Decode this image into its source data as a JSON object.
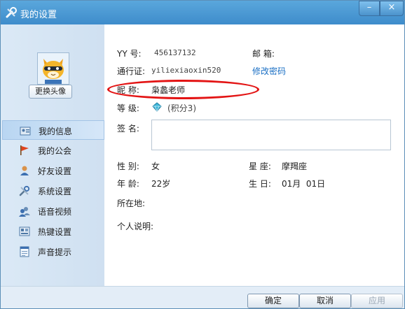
{
  "window": {
    "title": "我的设置",
    "minimize_glyph": "–",
    "close_glyph": "×"
  },
  "sidebar": {
    "change_avatar_label": "更换头像",
    "items": [
      {
        "label": "我的信息",
        "icon": "id-card-icon",
        "active": true
      },
      {
        "label": "我的公会",
        "icon": "flag-icon",
        "active": false
      },
      {
        "label": "好友设置",
        "icon": "user-icon",
        "active": false
      },
      {
        "label": "系统设置",
        "icon": "tools-icon",
        "active": false
      },
      {
        "label": "语音视频",
        "icon": "users-voice-icon",
        "active": false
      },
      {
        "label": "热键设置",
        "icon": "keyboard-icon",
        "active": false
      },
      {
        "label": "声音提示",
        "icon": "notepad-icon",
        "active": false
      }
    ]
  },
  "profile": {
    "yy_label": "YY 号:",
    "yy_value": "456137132",
    "email_label": "邮  箱:",
    "passport_label": "通行证:",
    "passport_value": "yiliexiaoxin520",
    "change_password_link": "修改密码",
    "nickname_label": "昵  称:",
    "nickname_value": "枭蠡老师",
    "level_label": "等  级:",
    "level_value": "(积分3)",
    "signature_label": "签  名:",
    "gender_label": "性  别:",
    "gender_value": "女",
    "constellation_label": "星  座:",
    "constellation_value": "摩羯座",
    "age_label": "年  龄:",
    "age_value": "22岁",
    "birthday_label": "生  日:",
    "birthday_value": "01月  01日",
    "location_label": "所在地:",
    "bio_label": "个人说明:"
  },
  "footer": {
    "ok_label": "确定",
    "cancel_label": "取消",
    "apply_label": "应用"
  },
  "colors": {
    "accent": "#3e8ccb",
    "link": "#1a6fc4",
    "annotation": "#e31414"
  }
}
